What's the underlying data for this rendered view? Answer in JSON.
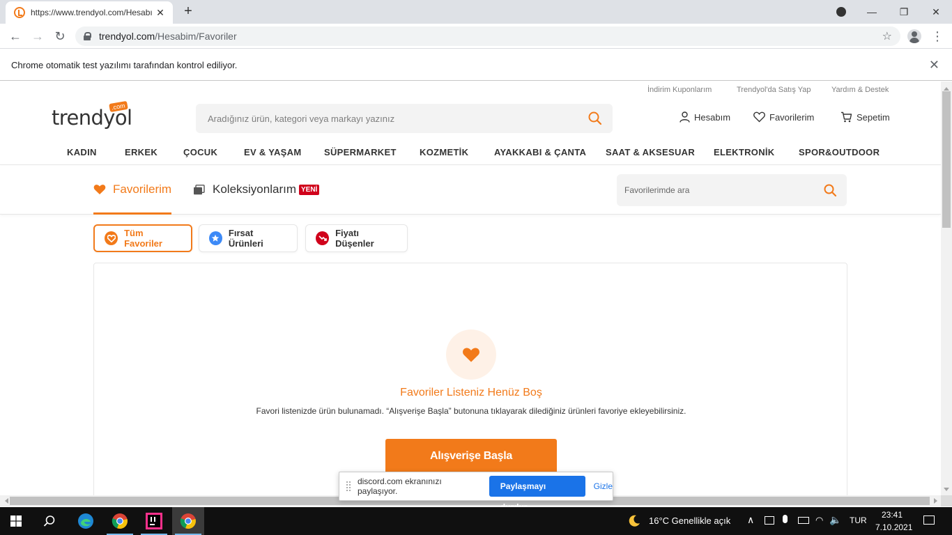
{
  "browser": {
    "tab_title": "https://www.trendyol.com/Hesabım/Favoriler",
    "url_domain": "trendyol.com",
    "url_path": "/Hesabim/Favoriler",
    "infobar_text": "Chrome otomatik test yazılımı tarafından kontrol ediliyor."
  },
  "site": {
    "logo": "trendyol",
    "logo_badge": ".com",
    "top_links": [
      "İndirim Kuponlarım",
      "Trendyol'da Satış Yap",
      "Yardım & Destek"
    ],
    "search_placeholder": "Aradığınız ürün, kategori veya markayı yazınız",
    "account_label": "Hesabım",
    "favorites_label": "Favorilerim",
    "cart_label": "Sepetim",
    "categories": [
      "KADIN",
      "ERKEK",
      "ÇOCUK",
      "EV & YAŞAM",
      "SÜPERMARKET",
      "KOZMETİK",
      "AYAKKABI & ÇANTA",
      "SAAT & AKSESUAR",
      "ELEKTRONİK",
      "SPOR&OUTDOOR"
    ],
    "accent_color": "#f27a1a"
  },
  "favorites": {
    "tab_favorites": "Favorilerim",
    "tab_collections": "Koleksiyonlarım",
    "new_badge": "YENİ",
    "search_placeholder": "Favorilerimde ara",
    "filters": [
      "Tüm Favoriler",
      "Fırsat Ürünleri",
      "Fiyatı Düşenler"
    ],
    "active_filter": "Tüm Favoriler",
    "empty_title": "Favoriler Listeniz Henüz Boş",
    "empty_desc": "Favori listenizde ürün bulunamadı. “Alışverişe Başla” butonuna tıklayarak dilediğiniz ürünleri favoriye ekleyebilirsiniz.",
    "shop_button": "Alışverişe Başla"
  },
  "share_bar": {
    "message": "discord.com ekranınızı paylaşıyor.",
    "stop_button": "Paylaşmayı durdur",
    "hide_link": "Gizle"
  },
  "taskbar": {
    "weather": "16°C  Genellikle açık",
    "language": "TUR",
    "time": "23:41",
    "date": "7.10.2021"
  }
}
